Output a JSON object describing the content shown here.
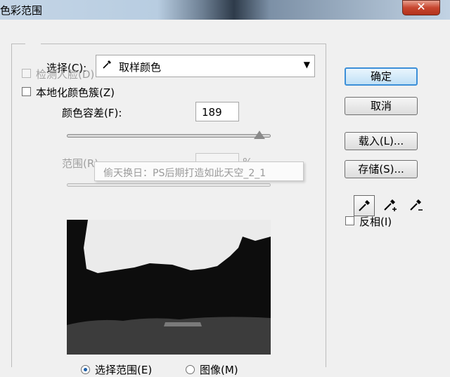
{
  "window": {
    "title": "色彩范围",
    "close_glyph": "✕"
  },
  "select": {
    "label": "选择(C):",
    "value": "取样颜色",
    "icon": "eyedropper-icon",
    "arrow": "▼"
  },
  "detect_faces": {
    "label": "检测人脸(D)",
    "checked": false,
    "enabled": false
  },
  "localized_clusters": {
    "label": "本地化颜色簇(Z)",
    "checked": false,
    "enabled": true
  },
  "fuzziness": {
    "label": "颜色容差(F):",
    "value": "189",
    "slider_fraction": 0.95
  },
  "range": {
    "label": "范围(R):",
    "value": "",
    "unit": "%",
    "enabled": false
  },
  "tooltip": {
    "text": "偷天换日：PS后期打造如此天空_2_1"
  },
  "buttons": {
    "ok": "确定",
    "cancel": "取消",
    "load": "载入(L)...",
    "save": "存储(S)..."
  },
  "tools": [
    "eyedropper-icon",
    "eyedropper-plus-icon",
    "eyedropper-minus-icon"
  ],
  "invert": {
    "label": "反相(I)",
    "checked": false
  },
  "view_mode": {
    "selection_label": "选择范围(E)",
    "image_label": "图像(M)",
    "selected": "selection"
  },
  "colors": {
    "default_button_border": "#3c8fd8",
    "close_button": "#c7462f"
  }
}
